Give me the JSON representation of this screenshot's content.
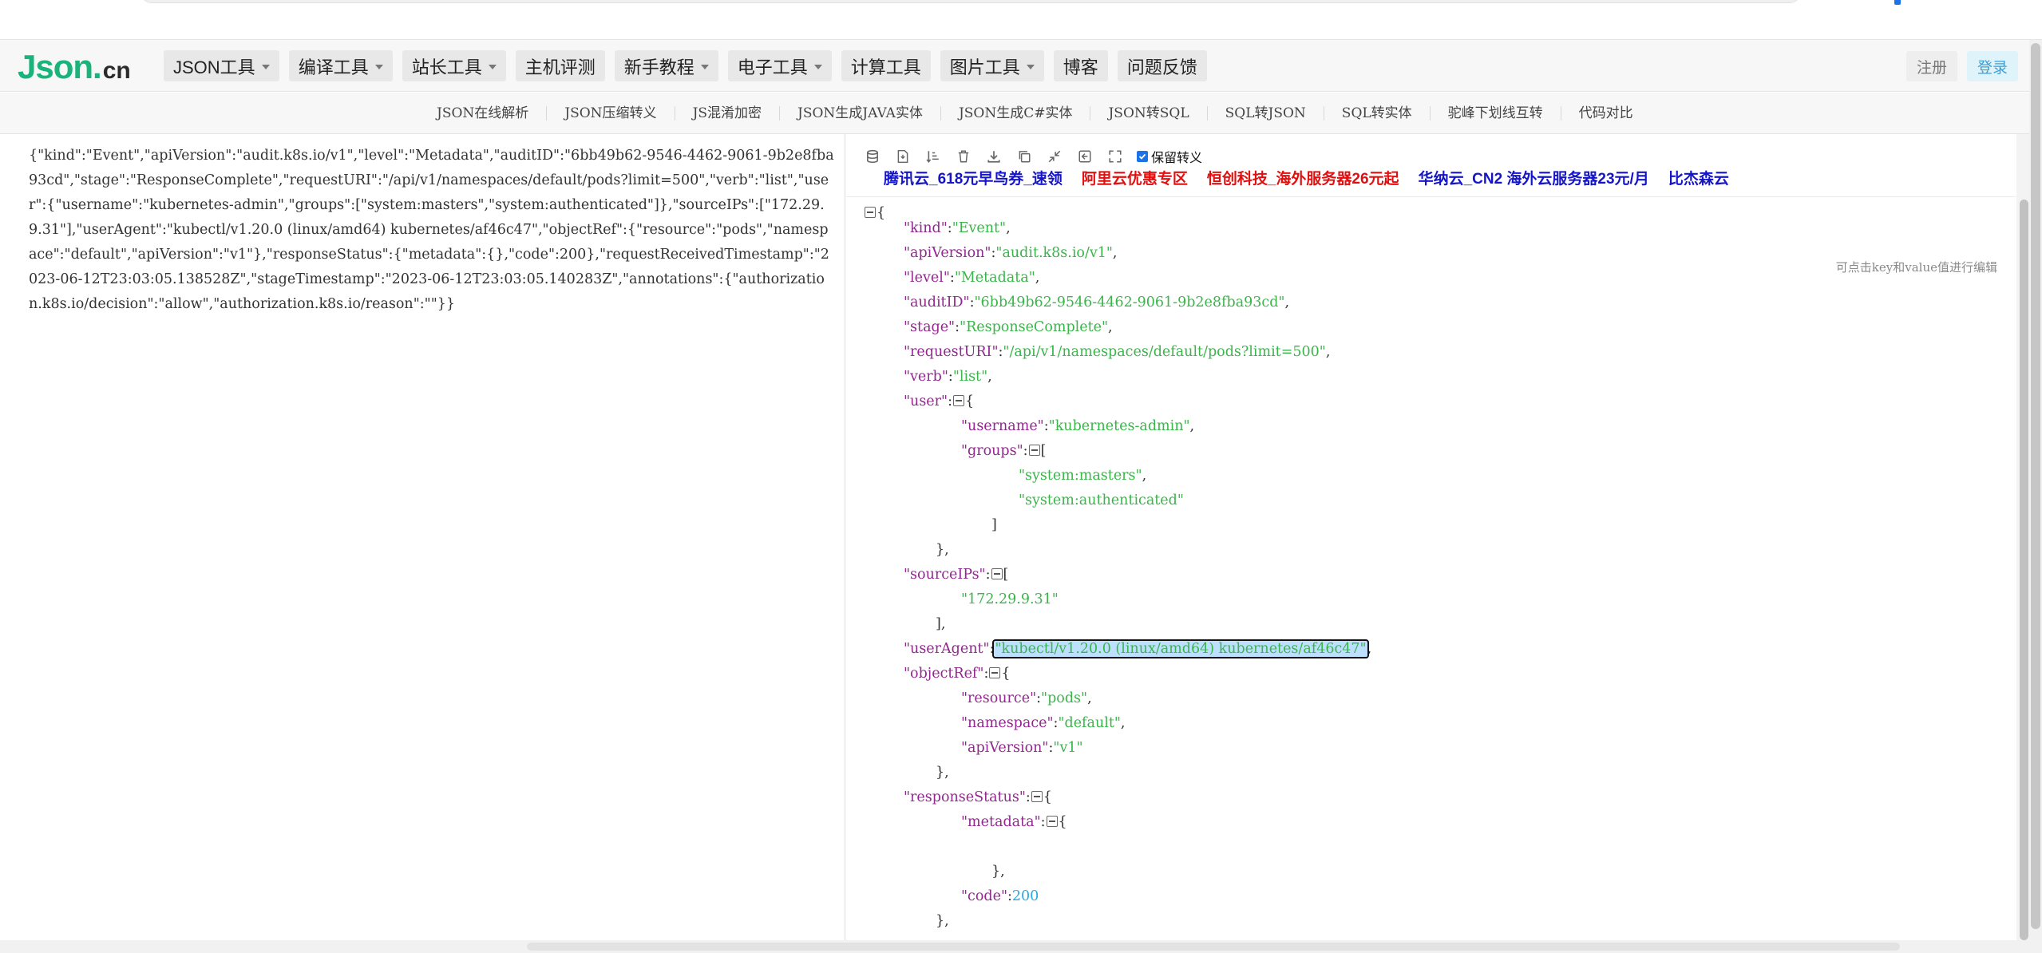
{
  "logo": {
    "main": "Json",
    "dot": ".",
    "tld": "cn"
  },
  "nav": [
    {
      "label": "JSON工具",
      "dropdown": true
    },
    {
      "label": "编译工具",
      "dropdown": true
    },
    {
      "label": "站长工具",
      "dropdown": true
    },
    {
      "label": "主机评测",
      "dropdown": false
    },
    {
      "label": "新手教程",
      "dropdown": true
    },
    {
      "label": "电子工具",
      "dropdown": true
    },
    {
      "label": "计算工具",
      "dropdown": false
    },
    {
      "label": "图片工具",
      "dropdown": true
    },
    {
      "label": "博客",
      "dropdown": false
    },
    {
      "label": "问题反馈",
      "dropdown": false
    }
  ],
  "auth": {
    "register": "注册",
    "login": "登录"
  },
  "subnav": [
    "JSON在线解析",
    "JSON压缩转义",
    "JS混淆加密",
    "JSON生成JAVA实体",
    "JSON生成C#实体",
    "JSON转SQL",
    "SQL转JSON",
    "SQL转实体",
    "驼峰下划线互转",
    "代码对比"
  ],
  "raw_input": "{\"kind\":\"Event\",\"apiVersion\":\"audit.k8s.io/v1\",\"level\":\"Metadata\",\"auditID\":\"6bb49b62-9546-4462-9061-9b2e8fba93cd\",\"stage\":\"ResponseComplete\",\"requestURI\":\"/api/v1/namespaces/default/pods?limit=500\",\"verb\":\"list\",\"user\":{\"username\":\"kubernetes-admin\",\"groups\":[\"system:masters\",\"system:authenticated\"]},\"sourceIPs\":[\"172.29.9.31\"],\"userAgent\":\"kubectl/v1.20.0 (linux/amd64) kubernetes/af46c47\",\"objectRef\":{\"resource\":\"pods\",\"namespace\":\"default\",\"apiVersion\":\"v1\"},\"responseStatus\":{\"metadata\":{},\"code\":200},\"requestReceivedTimestamp\":\"2023-06-12T23:03:05.138528Z\",\"stageTimestamp\":\"2023-06-12T23:03:05.140283Z\",\"annotations\":{\"authorization.k8s.io/decision\":\"allow\",\"authorization.k8s.io/reason\":\"\"}}",
  "toolbar": {
    "icons": [
      "database-icon",
      "file-icon",
      "sort-icon",
      "trash-icon",
      "download-icon",
      "copy-icon",
      "compress-icon",
      "screenshot-icon",
      "fullscreen-icon"
    ],
    "escape_label": "保留转义",
    "escape_checked": true
  },
  "ads": [
    {
      "label": "腾讯云_618元早鸟券_速领",
      "color": "blue"
    },
    {
      "label": "阿里云优惠专区",
      "color": "red"
    },
    {
      "label": "恒创科技_海外服务器26元起",
      "color": "red"
    },
    {
      "label": "华纳云_CN2 海外云服务器23元/月",
      "color": "blue"
    },
    {
      "label": "比杰森云",
      "color": "blue"
    }
  ],
  "edit_hint": "可点击key和value值进行编辑",
  "tree": {
    "kind": "Event",
    "apiVersion": "audit.k8s.io/v1",
    "level": "Metadata",
    "auditID": "6bb49b62-9546-4462-9061-9b2e8fba93cd",
    "stage": "ResponseComplete",
    "requestURI": "/api/v1/namespaces/default/pods?limit=500",
    "verb": "list",
    "username": "kubernetes-admin",
    "groups": [
      "system:masters",
      "system:authenticated"
    ],
    "sourceIPs": [
      "172.29.9.31"
    ],
    "userAgent": "kubectl/v1.20.0 (linux/amd64) kubernetes/af46c47",
    "objectRef": {
      "resource": "pods",
      "namespace": "default",
      "apiVersion": "v1"
    },
    "code": "200"
  },
  "keys": {
    "kind": "\"kind\"",
    "apiVersion": "\"apiVersion\"",
    "level": "\"level\"",
    "auditID": "\"auditID\"",
    "stage": "\"stage\"",
    "requestURI": "\"requestURI\"",
    "verb": "\"verb\"",
    "user": "\"user\"",
    "username": "\"username\"",
    "groups": "\"groups\"",
    "sourceIPs": "\"sourceIPs\"",
    "userAgent": "\"userAgent\"",
    "objectRef": "\"objectRef\"",
    "resource": "\"resource\"",
    "namespace": "\"namespace\"",
    "responseStatus": "\"responseStatus\"",
    "metadata": "\"metadata\"",
    "code": "\"code\""
  },
  "quoted": {
    "kind": "\"Event\"",
    "apiVersion": "\"audit.k8s.io/v1\"",
    "level": "\"Metadata\"",
    "auditID": "\"6bb49b62-9546-4462-9061-9b2e8fba93cd\"",
    "stage": "\"ResponseComplete\"",
    "requestURI": "\"/api/v1/namespaces/default/pods?limit=500\"",
    "verb": "\"list\"",
    "username": "\"kubernetes-admin\"",
    "group0": "\"system:masters\"",
    "group1": "\"system:authenticated\"",
    "ip0": "\"172.29.9.31\"",
    "userAgent": "\"kubectl/v1.20.0 (linux/amd64) kubernetes/af46c47\"",
    "resource": "\"pods\"",
    "namespace": "\"default\"",
    "objApiVersion": "\"v1\""
  },
  "colors": {
    "key": "#92278f",
    "string": "#3ab54a",
    "number": "#25aae1",
    "brand": "#18b47b",
    "highlight": "#bee0ff"
  }
}
